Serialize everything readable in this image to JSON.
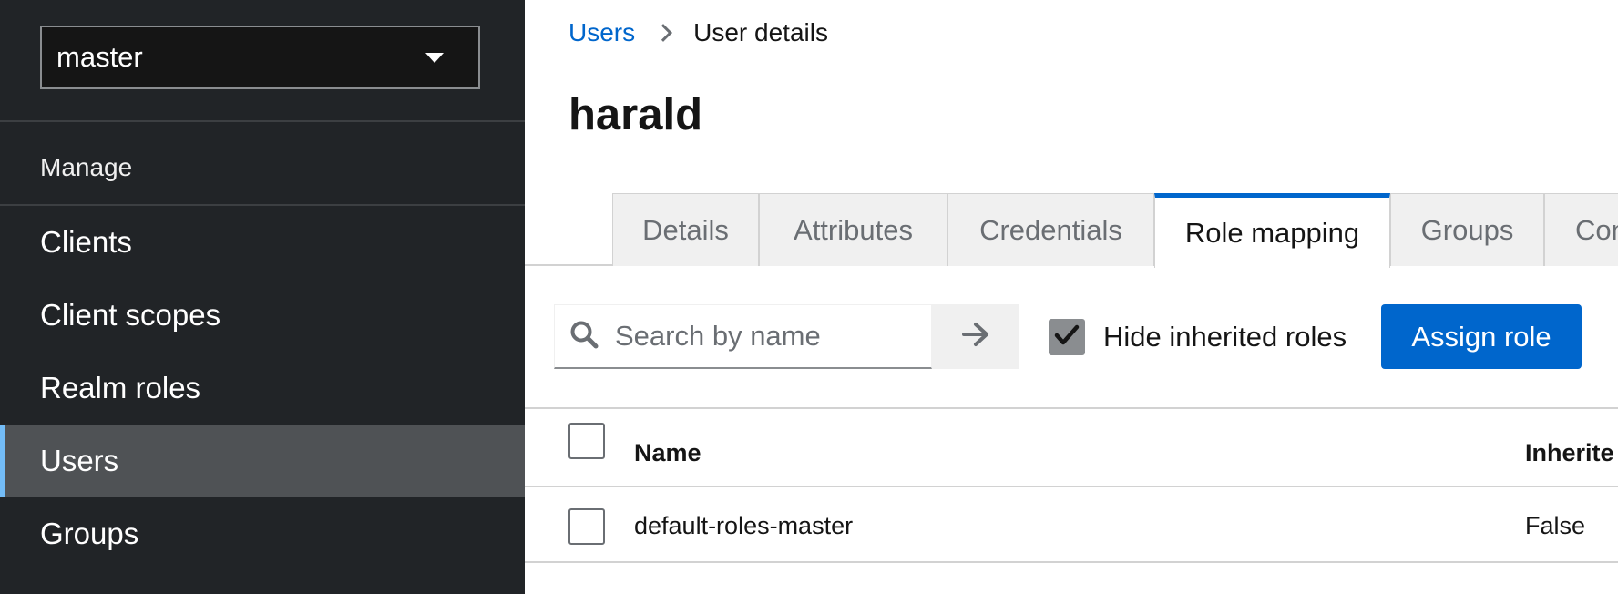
{
  "sidebar": {
    "realm": "master",
    "section_title": "Manage",
    "items": [
      {
        "label": "Clients"
      },
      {
        "label": "Client scopes"
      },
      {
        "label": "Realm roles"
      },
      {
        "label": "Users",
        "active": true
      },
      {
        "label": "Groups"
      }
    ]
  },
  "breadcrumb": {
    "parent": "Users",
    "current": "User details"
  },
  "page": {
    "title": "harald"
  },
  "tabs": [
    {
      "label": "Details"
    },
    {
      "label": "Attributes"
    },
    {
      "label": "Credentials"
    },
    {
      "label": "Role mapping",
      "active": true
    },
    {
      "label": "Groups"
    },
    {
      "label": "Con"
    }
  ],
  "toolbar": {
    "search_placeholder": "Search by name",
    "search_value": "",
    "hide_inherited_label": "Hide inherited roles",
    "hide_inherited_checked": true,
    "assign_label": "Assign role"
  },
  "table": {
    "columns": [
      "Name",
      "Inherite"
    ],
    "rows": [
      {
        "name": "default-roles-master",
        "inherited": "False"
      }
    ]
  },
  "colors": {
    "accent": "#0066cc",
    "sidebar_bg": "#212427",
    "sidebar_active": "#4f5255",
    "active_indicator": "#73bcf7"
  },
  "icons": {
    "realm_dropdown": "caret-down-icon",
    "search": "search-icon",
    "submit": "arrow-right-icon",
    "checked": "check-icon"
  }
}
